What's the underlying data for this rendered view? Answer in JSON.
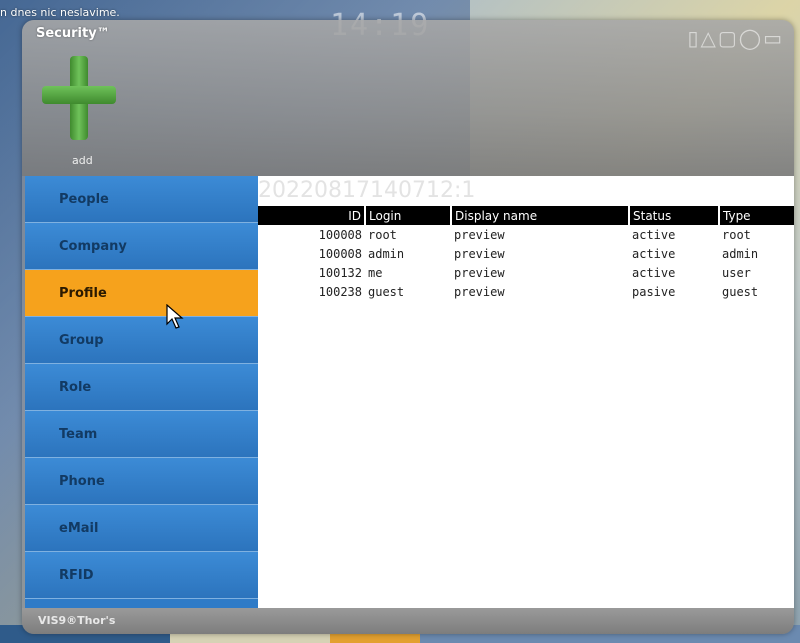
{
  "desktop": {
    "notice_text": "n dnes nic neslavime.",
    "clock": "14:19"
  },
  "window": {
    "title": "Security™",
    "icons_text": "▯△▢◯▭",
    "add_label": "add",
    "footer_label": "VIS9®Thor's"
  },
  "sidebar": {
    "items": [
      {
        "label": "People"
      },
      {
        "label": "Company"
      },
      {
        "label": "Profile",
        "active": true
      },
      {
        "label": "Group"
      },
      {
        "label": "Role"
      },
      {
        "label": "Team"
      },
      {
        "label": "Phone"
      },
      {
        "label": "eMail"
      },
      {
        "label": "RFID"
      }
    ]
  },
  "content": {
    "record_id": "20220817140712:1",
    "columns": [
      "ID",
      "Login",
      "Display name",
      "Status",
      "Type"
    ],
    "rows": [
      {
        "id": "100008",
        "login": "root",
        "display": "preview",
        "status": "active",
        "type": "root"
      },
      {
        "id": "100008",
        "login": "admin",
        "display": "preview",
        "status": "active",
        "type": "admin"
      },
      {
        "id": "100132",
        "login": "me",
        "display": "preview",
        "status": "active",
        "type": "user"
      },
      {
        "id": "100238",
        "login": "guest",
        "display": "preview",
        "status": "pasive",
        "type": "guest"
      }
    ]
  },
  "colors": {
    "sidebar": "#2f7bc7",
    "active": "#f6a21c",
    "add_green": "#5cb548"
  }
}
